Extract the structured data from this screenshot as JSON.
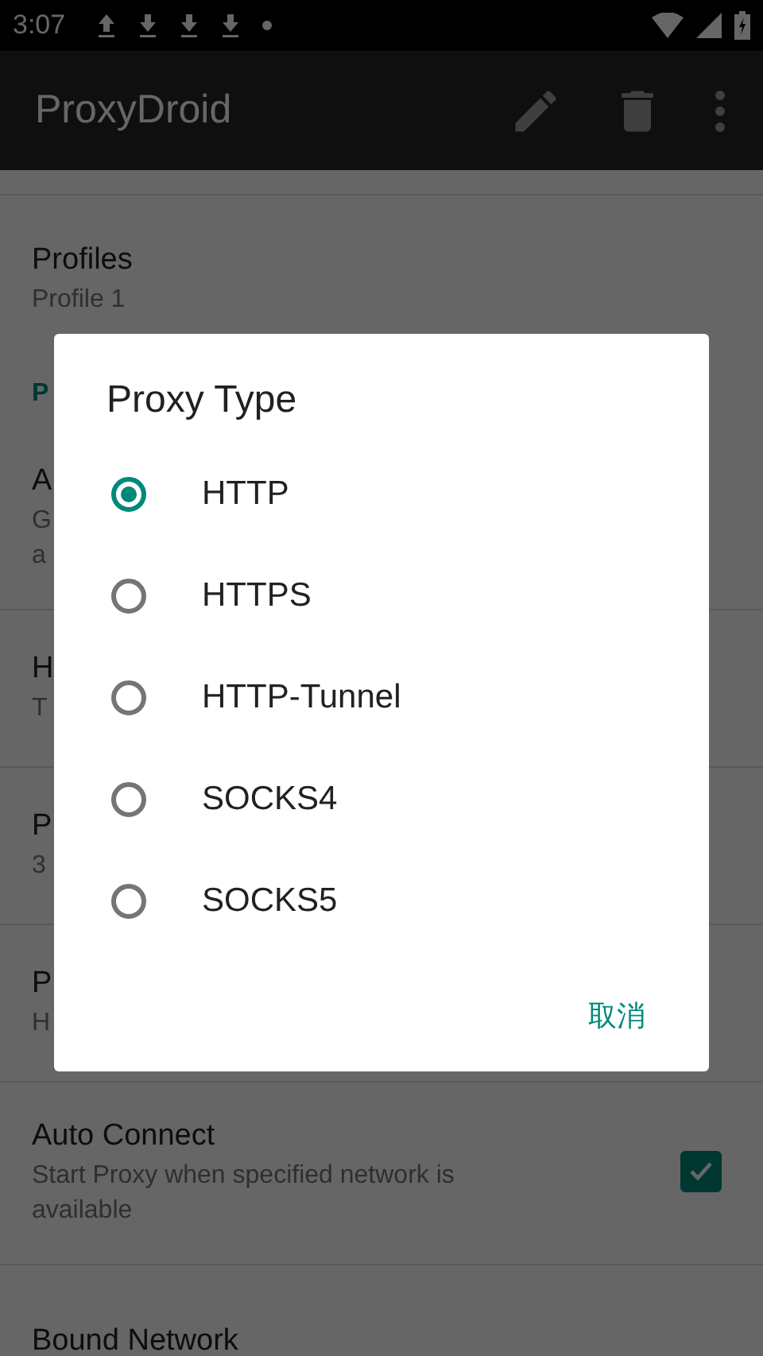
{
  "status_bar": {
    "time": "3:07"
  },
  "app_bar": {
    "title": "ProxyDroid"
  },
  "preferences": [
    {
      "kind": "item",
      "title": "Profiles",
      "summary": [
        "Profile 1"
      ]
    },
    {
      "kind": "category",
      "title": "P"
    },
    {
      "kind": "item",
      "title": "A",
      "summary": [
        "G",
        "a"
      ]
    },
    {
      "kind": "item",
      "title": "H",
      "summary": [
        "T"
      ]
    },
    {
      "kind": "item",
      "title": "P",
      "summary": [
        "3"
      ]
    },
    {
      "kind": "item",
      "title": "P",
      "summary": [
        "H"
      ]
    },
    {
      "kind": "checkbox",
      "title": "Auto Connect",
      "summary": [
        "Start Proxy when specified network is available"
      ],
      "checked": true
    },
    {
      "kind": "item",
      "title": "Bound Network"
    }
  ],
  "dialog": {
    "title": "Proxy Type",
    "options": [
      {
        "label": "HTTP",
        "selected": true
      },
      {
        "label": "HTTPS",
        "selected": false
      },
      {
        "label": "HTTP-Tunnel",
        "selected": false
      },
      {
        "label": "SOCKS4",
        "selected": false
      },
      {
        "label": "SOCKS5",
        "selected": false
      }
    ],
    "buttons": [
      "取消"
    ]
  }
}
